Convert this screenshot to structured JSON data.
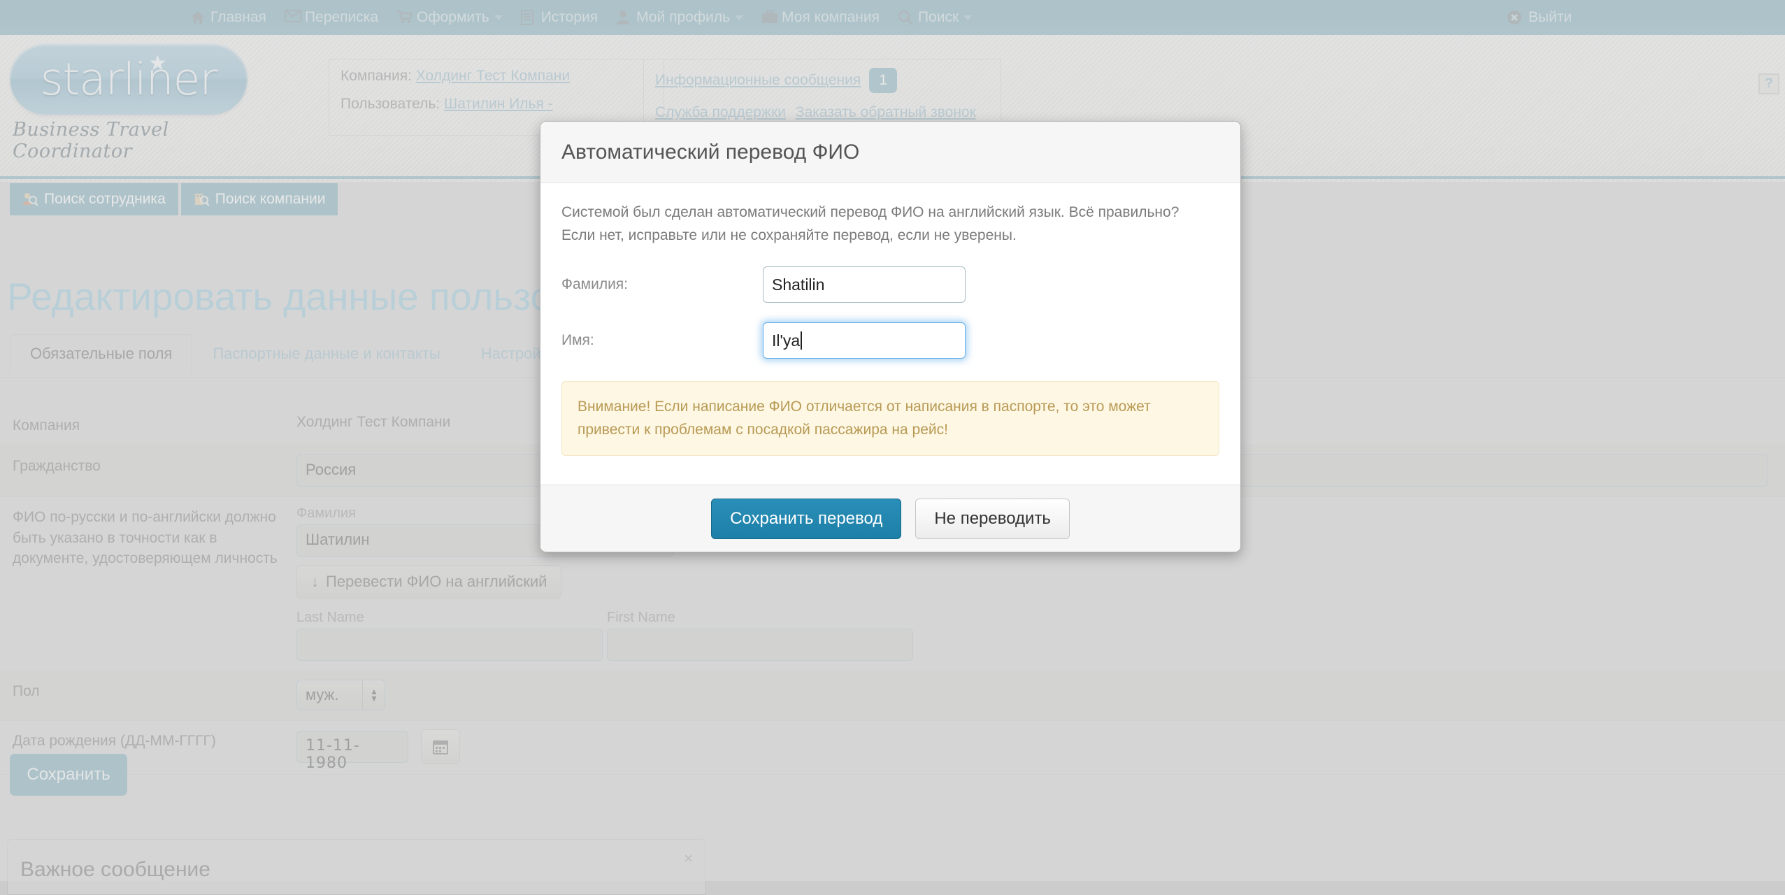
{
  "nav": {
    "items": [
      {
        "label": "Главная",
        "icon": "home-icon",
        "caret": false
      },
      {
        "label": "Переписка",
        "icon": "envelope-icon",
        "caret": false
      },
      {
        "label": "Оформить",
        "icon": "cart-icon",
        "caret": true
      },
      {
        "label": "История",
        "icon": "list-icon",
        "caret": false
      },
      {
        "label": "Мой профиль",
        "icon": "user-icon",
        "caret": true
      },
      {
        "label": "Моя компания",
        "icon": "briefcase-icon",
        "caret": false
      },
      {
        "label": "Поиск",
        "icon": "search-icon",
        "caret": true
      }
    ],
    "logout": "Выйти"
  },
  "brand": {
    "name": "starliner",
    "tagline": "Business Travel Coordinator"
  },
  "header": {
    "company_label": "Компания:",
    "company_value": "Холдинг Тест Компани",
    "user_label": "Пользователь:",
    "user_value": "Шатилин Илья -",
    "info_messages": "Информационные сообщения",
    "info_count": "1",
    "support": "Служба поддержки",
    "callback": "Заказать обратный звонок",
    "help": "?"
  },
  "subtabs": [
    {
      "label": "Поиск сотрудника",
      "icon": "people-search-icon"
    },
    {
      "label": "Поиск компании",
      "icon": "company-search-icon"
    }
  ],
  "page": {
    "title": "Редактировать данные пользователя"
  },
  "tabs": [
    {
      "label": "Обязательные поля",
      "active": true
    },
    {
      "label": "Паспортные данные и контакты",
      "active": false
    },
    {
      "label": "Настройки",
      "active": false
    }
  ],
  "form": {
    "rows": {
      "company_label": "Компания",
      "company_value": "Холдинг Тест Компани",
      "citizenship_label": "Гражданство",
      "citizenship_value": "Россия",
      "fio_label": "ФИО по-русски и по-английски должно быть указано в точности как в документе, удостоверяющем личность",
      "surname_field_label": "Фамилия",
      "surname_value": "Шатилин",
      "translate_button": "Перевести ФИО на английский",
      "translate_arrow": "↓",
      "last_name_label": "Last Name",
      "last_name_value": "",
      "first_name_label": "First Name",
      "first_name_value": "",
      "gender_label": "Пол",
      "gender_value": "муж.",
      "birthdate_label": "Дата рождения (ДД-ММ-ГГГГ)",
      "birthdate_value": "11-11-1980",
      "calendar_icon": "calendar-icon"
    },
    "save_button": "Сохранить"
  },
  "bottom_panel": {
    "title": "Важное сообщение",
    "close": "×"
  },
  "modal": {
    "title": "Автоматический перевод ФИО",
    "paragraph1": "Системой был сделан автоматический перевод ФИО на английский язык. Всё правильно?",
    "paragraph2": "Если нет, исправьте или не сохраняйте перевод, если не уверены.",
    "surname_label": "Фамилия:",
    "surname_value": "Shatilin",
    "firstname_label": "Имя:",
    "firstname_value": "Il'ya",
    "warning": "Внимание! Если написание ФИО отличается от написания в паспорте, то это может привести к проблемам с посадкой пассажира на рейс!",
    "save_button": "Сохранить перевод",
    "cancel_button": "Не переводить"
  },
  "colors": {
    "teal": "#74a6b6",
    "title_blue": "#8fc4d8",
    "primary_blue": "#1c7fa8",
    "warning_bg": "#fdf7e3",
    "warning_text": "#b99a55"
  }
}
